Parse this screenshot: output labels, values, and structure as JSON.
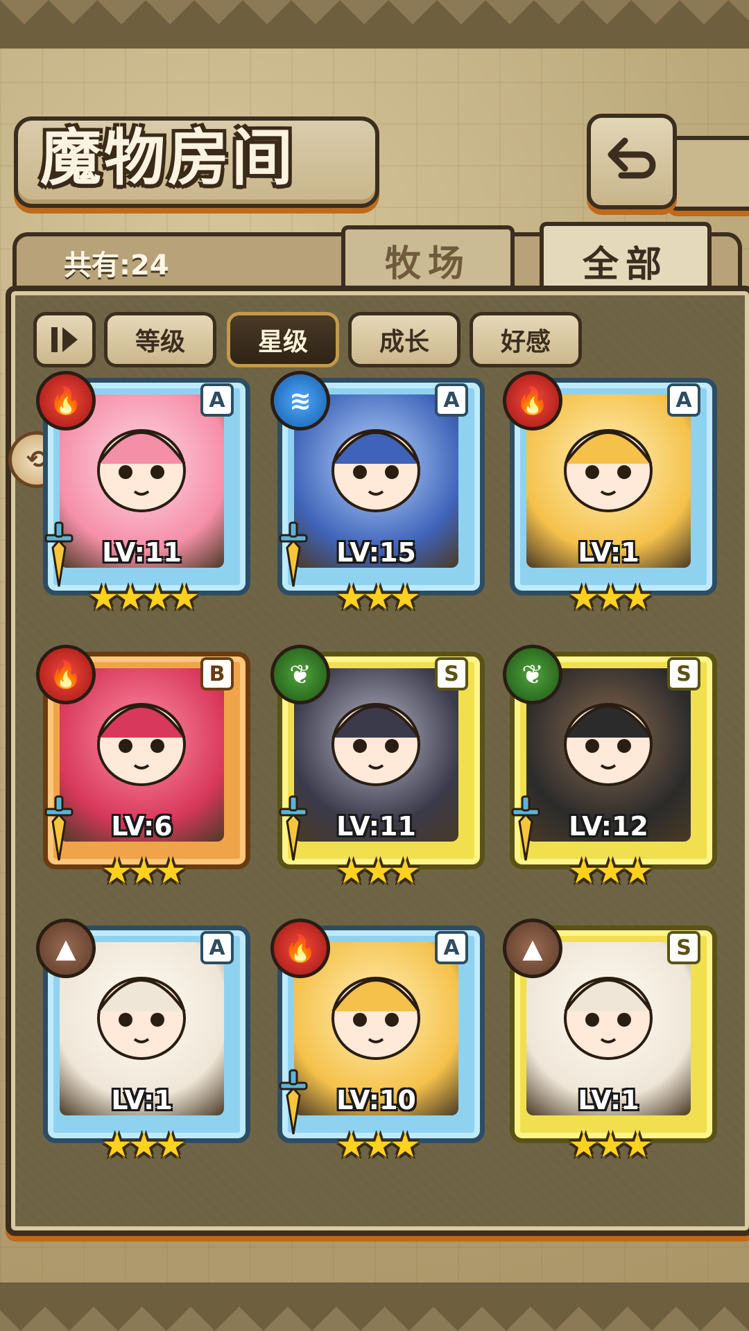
{
  "header": {
    "title": "魔物房间"
  },
  "count": {
    "label": "共有:24"
  },
  "tabs": [
    {
      "label": "牧场"
    },
    {
      "label": "全部"
    }
  ],
  "sort_buttons": [
    {
      "label": "等级"
    },
    {
      "label": "星级"
    },
    {
      "label": "成长"
    },
    {
      "label": "好感"
    }
  ],
  "monsters": [
    {
      "element": "fire-icon",
      "rank": "A",
      "level": "LV:11",
      "stars": 4,
      "frame": "blue"
    },
    {
      "element": "water-icon",
      "rank": "A",
      "level": "LV:15",
      "stars": 3,
      "frame": "blue"
    },
    {
      "element": "fire-icon",
      "rank": "A",
      "level": "LV:1",
      "stars": 3,
      "frame": "blue"
    },
    {
      "element": "fire-icon",
      "rank": "B",
      "level": "LV:6",
      "stars": 3,
      "frame": "orange"
    },
    {
      "element": "grass-icon",
      "rank": "S",
      "level": "LV:11",
      "stars": 3,
      "frame": "gold"
    },
    {
      "element": "grass-icon",
      "rank": "S",
      "level": "LV:12",
      "stars": 3,
      "frame": "gold"
    },
    {
      "element": "earth-icon",
      "rank": "A",
      "level": "LV:1",
      "stars": 3,
      "frame": "blue"
    },
    {
      "element": "fire-icon",
      "rank": "A",
      "level": "LV:10",
      "stars": 3,
      "frame": "blue"
    },
    {
      "element": "earth-icon",
      "rank": "S",
      "level": "LV:1",
      "stars": 3,
      "frame": "gold"
    }
  ],
  "stars_text": {
    "4": "★★★★",
    "3": "★★★"
  }
}
